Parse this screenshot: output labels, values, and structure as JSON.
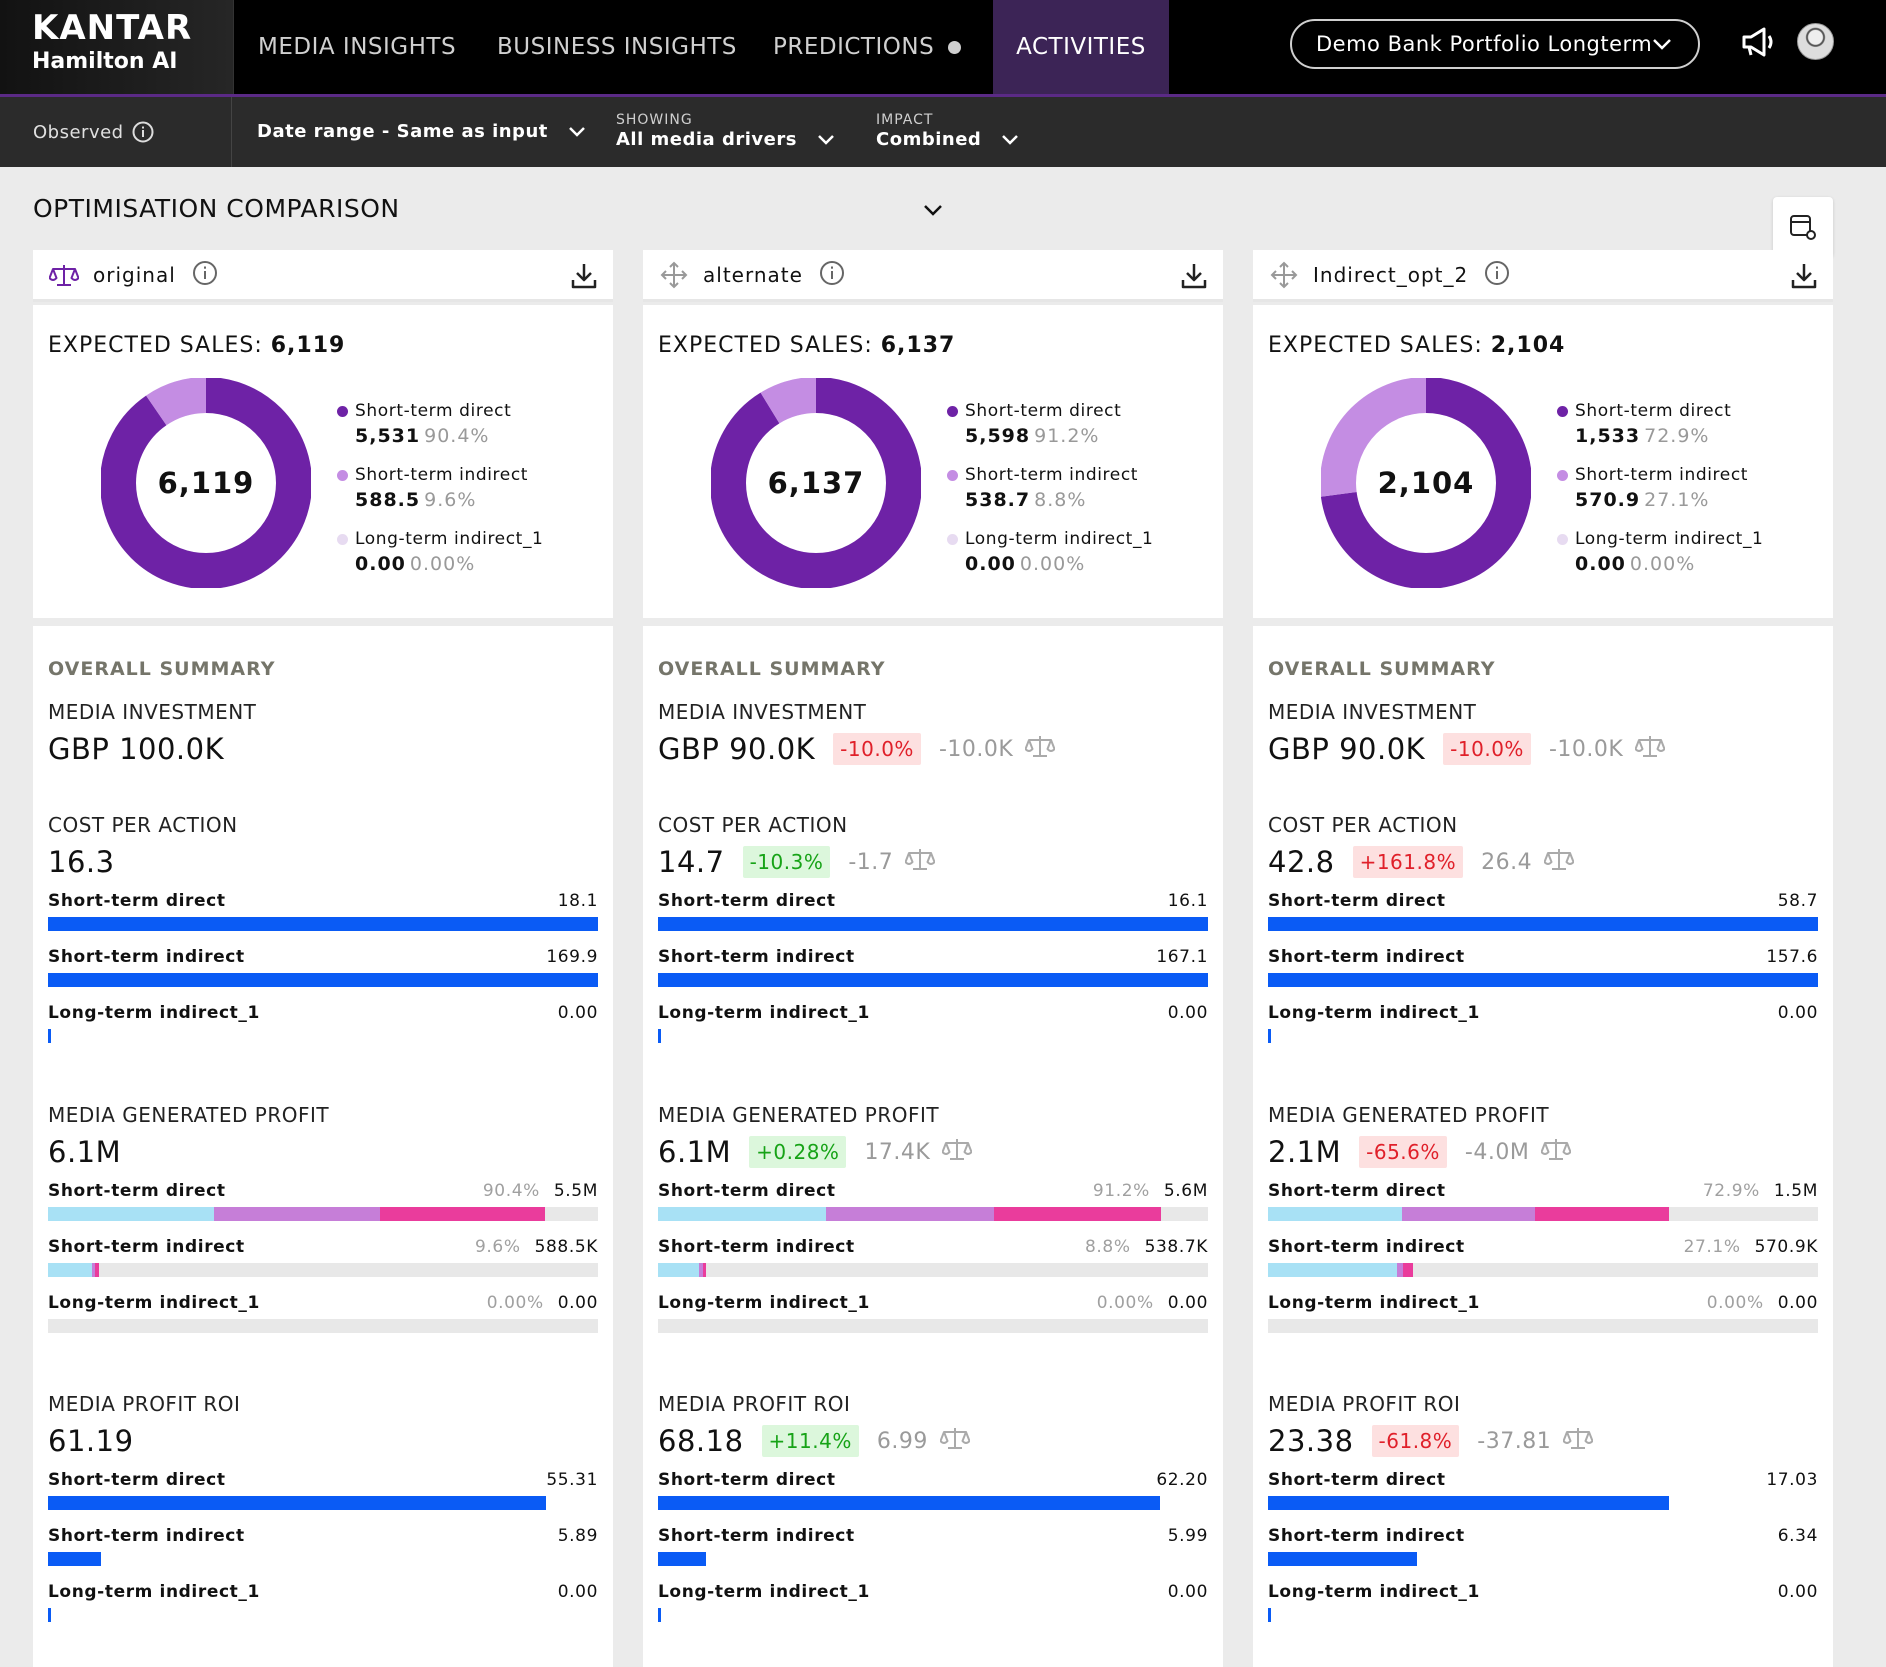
{
  "brand": {
    "name": "KANTAR",
    "product": "Hamilton AI"
  },
  "nav": {
    "tabs": [
      "MEDIA INSIGHTS",
      "BUSINESS INSIGHTS",
      "PREDICTIONS",
      "ACTIVITIES"
    ],
    "active_tab": "ACTIVITIES",
    "portfolio": "Demo Bank Portfolio Longterm"
  },
  "subbar": {
    "observed": "Observed",
    "date_range": "Date range - Same as input",
    "showing_caption": "SHOWING",
    "showing_value": "All media drivers",
    "impact_caption": "IMPACT",
    "impact_value": "Combined"
  },
  "section": {
    "title": "OPTIMISATION COMPARISON"
  },
  "colors": {
    "direct": "#6e22a6",
    "indirect": "#c48de3",
    "longterm": "#e7dbf1",
    "bar": "#0a5bf5",
    "seg1": "#a8e1f5",
    "seg2": "#c67ed8",
    "seg3": "#ea3c9c"
  },
  "labels": {
    "expected_sales": "EXPECTED SALES:",
    "overall_summary": "OVERALL SUMMARY",
    "media_investment": "MEDIA INVESTMENT",
    "cost_per_action": "COST PER ACTION",
    "media_generated_profit": "MEDIA GENERATED PROFIT",
    "media_profit_roi": "MEDIA PROFIT ROI",
    "short_term_direct": "Short-term direct",
    "short_term_indirect": "Short-term indirect",
    "long_term_indirect": "Long-term indirect_1"
  },
  "scenarios": [
    {
      "name": "original",
      "icon": "scale-icon",
      "expected_sales": "6,119",
      "donut": {
        "center": "6,119",
        "direct_share": 0.904,
        "indirect_share": 0.096,
        "longterm_share": 0.0
      },
      "legend": [
        {
          "value": "5,531",
          "pct": "90.4%"
        },
        {
          "value": "588.5",
          "pct": "9.6%"
        },
        {
          "value": "0.00",
          "pct": "0.00%"
        }
      ],
      "investment": {
        "value": "GBP 100.0K",
        "badge": "",
        "delta": ""
      },
      "cpa": {
        "value": "16.3",
        "badge": "",
        "delta": "",
        "rows": [
          {
            "value": "18.1",
            "level": 1.0
          },
          {
            "value": "169.9",
            "level": 1.0
          },
          {
            "value": "0.00",
            "level": 0.0
          }
        ]
      },
      "profit": {
        "value": "6.1M",
        "badge": "",
        "delta": "",
        "rows": [
          {
            "pct": "90.4%",
            "value": "5.5M",
            "segs": [
              0.302,
              0.302,
              0.3
            ]
          },
          {
            "pct": "9.6%",
            "value": "588.5K",
            "segs": [
              0.08,
              0.006,
              0.006
            ]
          },
          {
            "pct": "0.00%",
            "value": "0.00",
            "segs": [
              0,
              0,
              0
            ]
          }
        ]
      },
      "roi": {
        "value": "61.19",
        "badge": "",
        "delta": "",
        "rows": [
          {
            "value": "55.31",
            "level": 0.905
          },
          {
            "value": "5.89",
            "level": 0.096
          },
          {
            "value": "0.00",
            "level": 0.0
          }
        ]
      }
    },
    {
      "name": "alternate",
      "icon": "move-icon",
      "expected_sales": "6,137",
      "donut": {
        "center": "6,137",
        "direct_share": 0.912,
        "indirect_share": 0.088,
        "longterm_share": 0.0
      },
      "legend": [
        {
          "value": "5,598",
          "pct": "91.2%"
        },
        {
          "value": "538.7",
          "pct": "8.8%"
        },
        {
          "value": "0.00",
          "pct": "0.00%"
        }
      ],
      "investment": {
        "value": "GBP 90.0K",
        "badge": "-10.0%",
        "badge_tone": "red",
        "delta": "-10.0K"
      },
      "cpa": {
        "value": "14.7",
        "badge": "-10.3%",
        "badge_tone": "green",
        "delta": "-1.7",
        "rows": [
          {
            "value": "16.1",
            "level": 1.0
          },
          {
            "value": "167.1",
            "level": 1.0
          },
          {
            "value": "0.00",
            "level": 0.0
          }
        ]
      },
      "profit": {
        "value": "6.1M",
        "badge": "+0.28%",
        "badge_tone": "green",
        "delta": "17.4K",
        "rows": [
          {
            "pct": "91.2%",
            "value": "5.6M",
            "segs": [
              0.305,
              0.305,
              0.305
            ]
          },
          {
            "pct": "8.8%",
            "value": "538.7K",
            "segs": [
              0.075,
              0.006,
              0.006
            ]
          },
          {
            "pct": "0.00%",
            "value": "0.00",
            "segs": [
              0,
              0,
              0
            ]
          }
        ]
      },
      "roi": {
        "value": "68.18",
        "badge": "+11.4%",
        "badge_tone": "green",
        "delta": "6.99",
        "rows": [
          {
            "value": "62.20",
            "level": 0.912
          },
          {
            "value": "5.99",
            "level": 0.088
          },
          {
            "value": "0.00",
            "level": 0.0
          }
        ]
      }
    },
    {
      "name": "Indirect_opt_2",
      "icon": "move-icon",
      "expected_sales": "2,104",
      "donut": {
        "center": "2,104",
        "direct_share": 0.729,
        "indirect_share": 0.271,
        "longterm_share": 0.0
      },
      "legend": [
        {
          "value": "1,533",
          "pct": "72.9%"
        },
        {
          "value": "570.9",
          "pct": "27.1%"
        },
        {
          "value": "0.00",
          "pct": "0.00%"
        }
      ],
      "investment": {
        "value": "GBP 90.0K",
        "badge": "-10.0%",
        "badge_tone": "red",
        "delta": "-10.0K"
      },
      "cpa": {
        "value": "42.8",
        "badge": "+161.8%",
        "badge_tone": "red",
        "delta": "26.4",
        "rows": [
          {
            "value": "58.7",
            "level": 1.0
          },
          {
            "value": "157.6",
            "level": 1.0
          },
          {
            "value": "0.00",
            "level": 0.0
          }
        ]
      },
      "profit": {
        "value": "2.1M",
        "badge": "-65.6%",
        "badge_tone": "red",
        "delta": "-4.0M",
        "rows": [
          {
            "pct": "72.9%",
            "value": "1.5M",
            "segs": [
              0.243,
              0.243,
              0.243
            ]
          },
          {
            "pct": "27.1%",
            "value": "570.9K",
            "segs": [
              0.235,
              0.01,
              0.018
            ]
          },
          {
            "pct": "0.00%",
            "value": "0.00",
            "segs": [
              0,
              0,
              0
            ]
          }
        ]
      },
      "roi": {
        "value": "23.38",
        "badge": "-61.8%",
        "badge_tone": "red",
        "delta": "-37.81",
        "rows": [
          {
            "value": "17.03",
            "level": 0.729
          },
          {
            "value": "6.34",
            "level": 0.271
          },
          {
            "value": "0.00",
            "level": 0.0
          }
        ]
      }
    }
  ]
}
